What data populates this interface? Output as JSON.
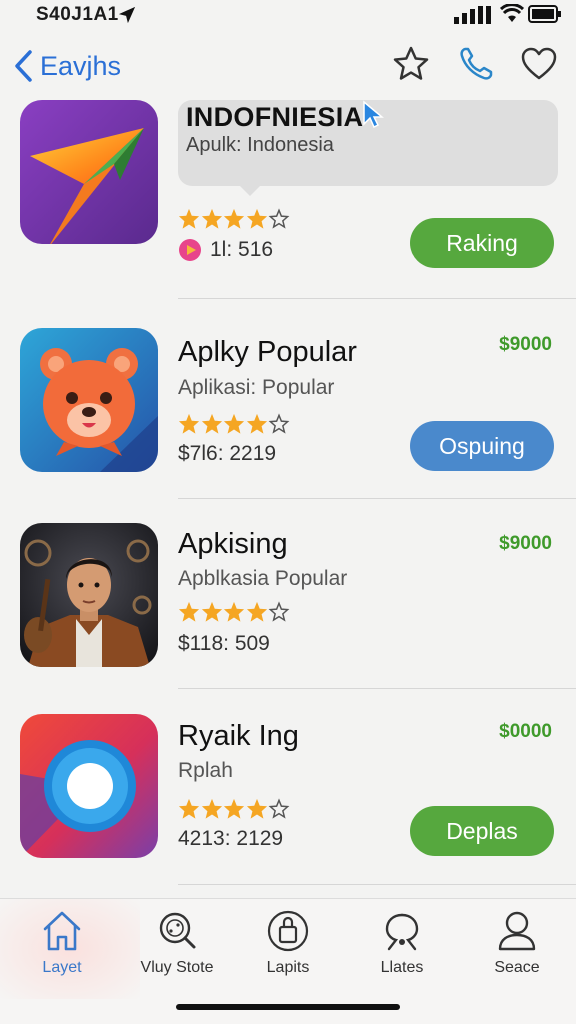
{
  "status_bar": {
    "time": "S40J1A1"
  },
  "nav": {
    "back_label": "Eavjhs"
  },
  "tooltip": {
    "title": "INDOFNIESIA",
    "subtitle": "Apulk: Indonesia"
  },
  "apps": [
    {
      "name": "",
      "subtitle": "",
      "rating": 4,
      "meta": "1l: 516",
      "price": "",
      "button": "Raking",
      "button_color": "#56a83e"
    },
    {
      "name": "Aplky Popular",
      "subtitle": "Aplikasi: Popular",
      "rating": 4,
      "meta": "$7l6: 2219",
      "price": "$9000",
      "button": "Ospuing",
      "button_color": "#4a89cc"
    },
    {
      "name": "Apkising",
      "subtitle": "Apblkasia Popular",
      "rating": 4,
      "meta": "$118: 509",
      "price": "$9000",
      "button": "",
      "button_color": ""
    },
    {
      "name": "Ryaik Ing",
      "subtitle": "Rplah",
      "rating": 4,
      "meta": "4213: 2129",
      "price": "$0000",
      "button": "Deplas",
      "button_color": "#56a83e"
    }
  ],
  "tabs": [
    {
      "label": "Layet",
      "icon": "home-icon",
      "active": true
    },
    {
      "label": "Vluy Stote",
      "icon": "search-globe-icon",
      "active": false
    },
    {
      "label": "Lapits",
      "icon": "bag-icon",
      "active": false
    },
    {
      "label": "Llates",
      "icon": "tag-icon",
      "active": false
    },
    {
      "label": "Seace",
      "icon": "person-icon",
      "active": false
    }
  ],
  "colors": {
    "accent_blue": "#2a6fd6",
    "price_green": "#3f9a2b",
    "star": "#f5a623"
  }
}
